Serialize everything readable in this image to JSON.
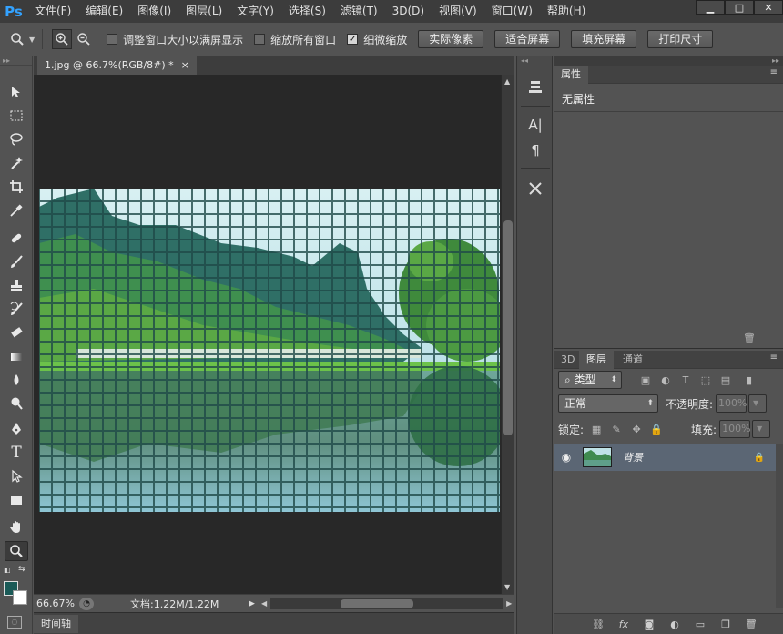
{
  "app": {
    "logo": "Ps"
  },
  "menu": [
    "文件(F)",
    "编辑(E)",
    "图像(I)",
    "图层(L)",
    "文字(Y)",
    "选择(S)",
    "滤镜(T)",
    "3D(D)",
    "视图(V)",
    "窗口(W)",
    "帮助(H)"
  ],
  "window_controls": {
    "minimize": "▁",
    "restore": "□",
    "close": "✕"
  },
  "options": {
    "resize_windows_label": "调整窗口大小以满屏显示",
    "zoom_all_label": "缩放所有窗口",
    "scrubby_zoom_label": "细微缩放",
    "scrubby_zoom_checked": true,
    "actual_pixels": "实际像素",
    "fit_screen": "适合屏幕",
    "fill_screen": "填充屏幕",
    "print_size": "打印尺寸"
  },
  "document": {
    "tab_title": "1.jpg @ 66.7%(RGB/8#) *",
    "tab_close": "×"
  },
  "status": {
    "zoom": "66.67%",
    "doc_size": "文档:1.22M/1.22M"
  },
  "timeline": {
    "label": "时间轴"
  },
  "properties": {
    "tab_label": "属性",
    "no_properties": "无属性"
  },
  "layers": {
    "tabs": [
      "3D",
      "图层",
      "通道"
    ],
    "filter_kind": "类型",
    "blend_mode": "正常",
    "opacity_label": "不透明度:",
    "opacity_value": "100%",
    "lock_label": "锁定:",
    "fill_label": "填充:",
    "fill_value": "100%",
    "layer_name": "背景"
  },
  "colors": {
    "foreground": "#1a5a57",
    "background": "#ffffff",
    "accent": "#33a2ff",
    "selected_layer": "#5b6674"
  }
}
